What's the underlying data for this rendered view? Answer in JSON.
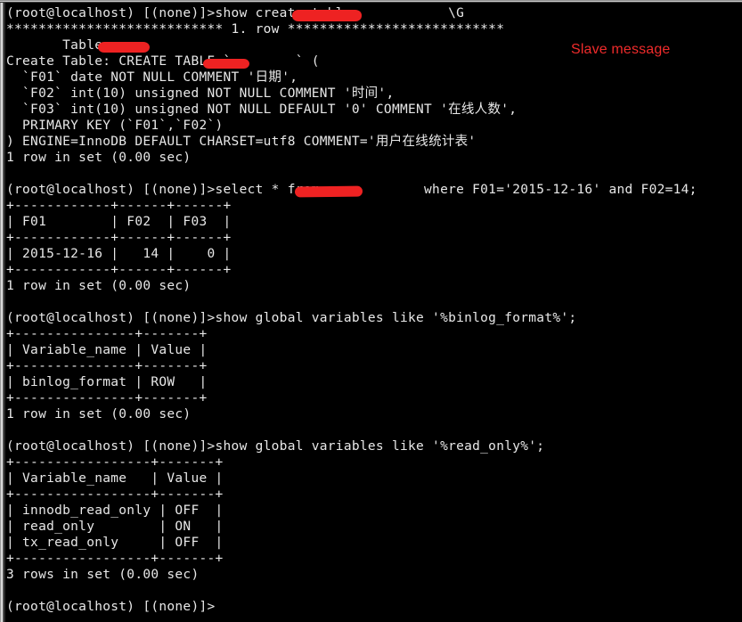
{
  "terminal": {
    "background_color": "#000000",
    "text_color": "#e8e8e8",
    "prompt": "(root@localhost) [(none)]>",
    "lines": [
      "(root@localhost) [(none)]>show create table            \\G",
      "*************************** 1. row ***************************",
      "       Table: ",
      "Create Table: CREATE TABLE `        ` (",
      "  `F01` date NOT NULL COMMENT '日期',",
      "  `F02` int(10) unsigned NOT NULL COMMENT '时间',",
      "  `F03` int(10) unsigned NOT NULL DEFAULT '0' COMMENT '在线人数',",
      "  PRIMARY KEY (`F01`,`F02`)",
      ") ENGINE=InnoDB DEFAULT CHARSET=utf8 COMMENT='用户在线统计表'",
      "1 row in set (0.00 sec)",
      "",
      "(root@localhost) [(none)]>select * from             where F01='2015-12-16' and F02=14;",
      "+------------+------+------+",
      "| F01        | F02  | F03  |",
      "+------------+------+------+",
      "| 2015-12-16 |   14 |    0 |",
      "+------------+------+------+",
      "1 row in set (0.00 sec)",
      "",
      "(root@localhost) [(none)]>show global variables like '%binlog_format%';",
      "+---------------+-------+",
      "| Variable_name | Value |",
      "+---------------+-------+",
      "| binlog_format | ROW   |",
      "+---------------+-------+",
      "1 row in set (0.00 sec)",
      "",
      "(root@localhost) [(none)]>show global variables like '%read_only%';",
      "+-----------------+-------+",
      "| Variable_name   | Value |",
      "+-----------------+-------+",
      "| innodb_read_only | OFF  |",
      "| read_only        | ON   |",
      "| tx_read_only     | OFF  |",
      "+-----------------+-------+",
      "3 rows in set (0.00 sec)",
      "",
      "(root@localhost) [(none)]>"
    ]
  },
  "annotation": {
    "label": "Slave message",
    "color": "#ef2b2b"
  },
  "redactions": {
    "count": 4,
    "color": "#ee2222",
    "note": "table name censored"
  },
  "queries": {
    "show_create_table": "show create table  \\G",
    "select_row": "select * from  where F01='2015-12-16' and F02=14;",
    "show_binlog_format": "show global variables like '%binlog_format%';",
    "show_read_only": "show global variables like '%read_only%';"
  },
  "results": {
    "create_table_row_header": "*************************** 1. row ***************************",
    "table_label": "       Table: ",
    "create_table_ddl": [
      "Create Table: CREATE TABLE `        ` (",
      "  `F01` date NOT NULL COMMENT '日期',",
      "  `F02` int(10) unsigned NOT NULL COMMENT '时间',",
      "  `F03` int(10) unsigned NOT NULL DEFAULT '0' COMMENT '在线人数',",
      "  PRIMARY KEY (`F01`,`F02`)",
      ") ENGINE=InnoDB DEFAULT CHARSET=utf8 COMMENT='用户在线统计表'"
    ],
    "select_table": {
      "columns": [
        "F01",
        "F02",
        "F03"
      ],
      "rows": [
        [
          "2015-12-16",
          "14",
          "0"
        ]
      ],
      "footer": "1 row in set (0.00 sec)"
    },
    "binlog_table": {
      "columns": [
        "Variable_name",
        "Value"
      ],
      "rows": [
        [
          "binlog_format",
          "ROW"
        ]
      ],
      "footer": "1 row in set (0.00 sec)"
    },
    "read_only_table": {
      "columns": [
        "Variable_name",
        "Value"
      ],
      "rows": [
        [
          "innodb_read_only",
          "OFF"
        ],
        [
          "read_only",
          "ON"
        ],
        [
          "tx_read_only",
          "OFF"
        ]
      ],
      "footer": "3 rows in set (0.00 sec)"
    },
    "create_table_footer": "1 row in set (0.00 sec)"
  }
}
